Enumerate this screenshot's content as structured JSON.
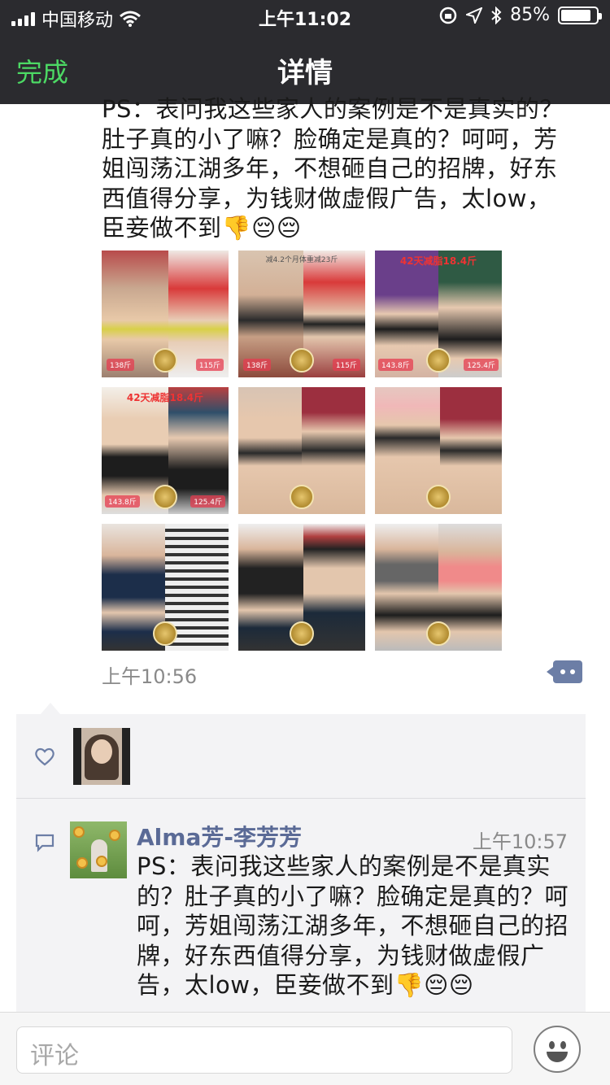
{
  "status_bar": {
    "carrier": "中国移动",
    "time": "上午11:02",
    "battery": "85%"
  },
  "nav": {
    "done_label": "完成",
    "title": "详情"
  },
  "post": {
    "text": "PS：表问我这些家人的案例是不是真实的？肚子真的小了嘛？脸确定是真的？呵呵，芳姐闯荡江湖多年，不想砸自己的招牌，好东西值得分享，为钱财做虚假广告，太low，臣妾做不到👎😔😔",
    "time": "上午10:56",
    "photos": [
      {
        "caption": "",
        "tags": [
          "138斤",
          "115斤"
        ]
      },
      {
        "caption": "减4.2个月体重减23斤",
        "tags": [
          "138斤",
          "115斤"
        ]
      },
      {
        "caption": "42天减脂18.4斤",
        "tags": [
          "143.8斤",
          "125.4斤"
        ]
      },
      {
        "caption": "42天减脂18.4斤",
        "tags": [
          "143.8斤",
          "125.4斤"
        ]
      },
      {
        "caption": "",
        "tags": []
      },
      {
        "caption": "",
        "tags": []
      },
      {
        "caption": "",
        "tags": []
      },
      {
        "caption": "",
        "tags": []
      },
      {
        "caption": "",
        "tags": []
      }
    ]
  },
  "comment": {
    "author": "Alma芳-李芳芳",
    "time": "上午10:57",
    "text": "PS：表问我这些家人的案例是不是真实的？肚子真的小了嘛？脸确定是真的？呵呵，芳姐闯荡江湖多年，不想砸自己的招牌，好东西值得分享，为钱财做虚假广告，太low，臣妾做不到👎😔😔"
  },
  "input": {
    "placeholder": "评论"
  },
  "colors": {
    "nav_bg": "#2b2b2f",
    "done_green": "#4cd964",
    "name_blue": "#5a6a96",
    "panel_bg": "#f3f3f5"
  }
}
